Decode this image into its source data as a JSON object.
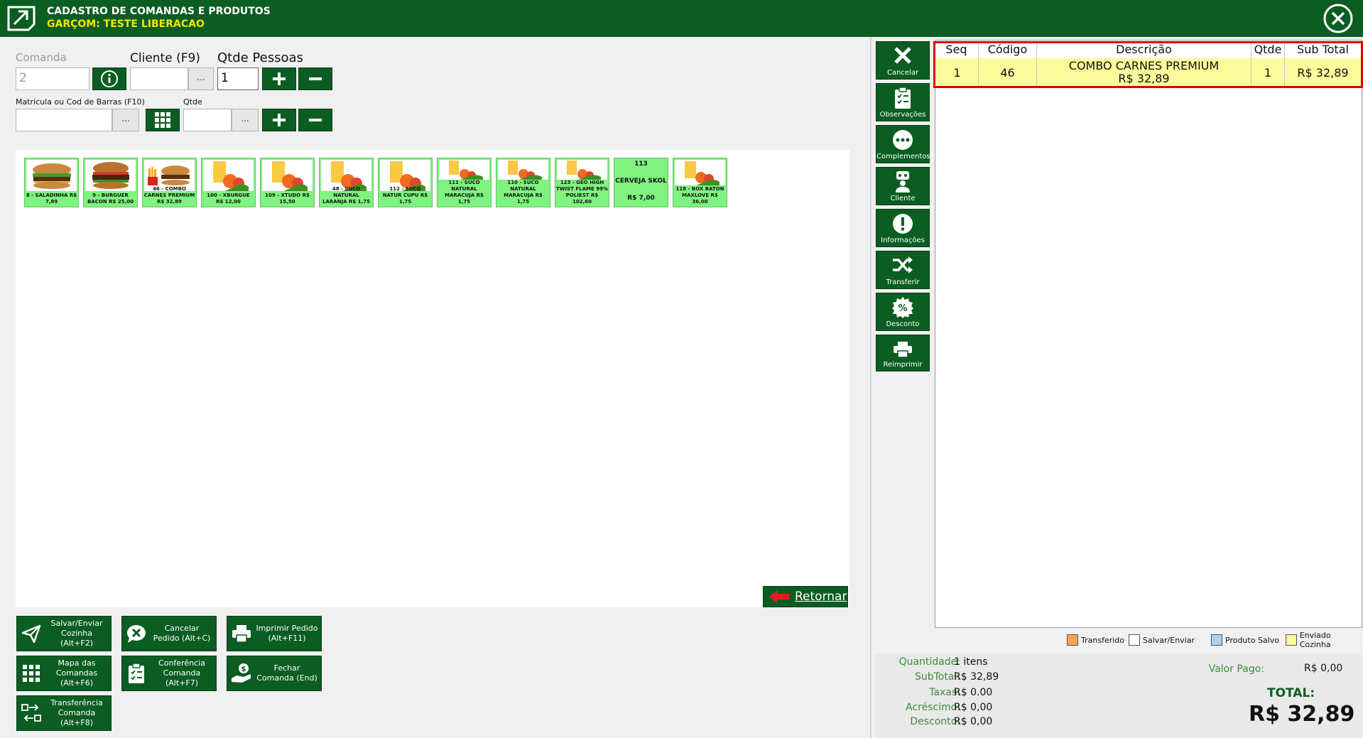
{
  "header": {
    "title": "CADASTRO DE COMANDAS E PRODUTOS",
    "subtitle": "GARÇOM: TESTE LIBERACAO"
  },
  "form": {
    "comanda_label": "Comanda",
    "comanda_value": "2",
    "cliente_label": "Cliente (F9)",
    "cliente_value": "",
    "pessoas_label": "Qtde Pessoas",
    "pessoas_value": "1",
    "matricula_label": "Matricula ou Cod de Barras (F10)",
    "matricula_value": "",
    "qtde_label": "Qtde",
    "qtde_value": "",
    "dots": "..."
  },
  "products": [
    {
      "caption": "8 - SALADINHA  R$ 7,89",
      "img": "burger"
    },
    {
      "caption": "9 - BURGUER BACON  R$ 25,00",
      "img": "burger2"
    },
    {
      "caption": "46 - COMBO CARNES PREMIUM R$ 32,89",
      "img": "combo"
    },
    {
      "caption": "100 - XBURGUE R$ 12,00",
      "img": "juice"
    },
    {
      "caption": "109 - XTUDO  R$ 15,50",
      "img": "juice"
    },
    {
      "caption": "48 - SUCO NATURAL LARANJA  R$ 1,75",
      "img": "juice"
    },
    {
      "caption": "112 - SUCO NATUR CUPU  R$ 1,75",
      "img": "juice"
    },
    {
      "caption": "111 - SUCO NATURAL MARACUJA  R$ 1,75",
      "img": "juice"
    },
    {
      "caption": "110 - SUCO NATURAL MARACUJA  R$ 1,75",
      "img": "juice"
    },
    {
      "caption": "123 - GEO HIGH TWIST FLAME 99% POLIEST  R$ 102,60",
      "img": "juice"
    },
    {
      "code": "113",
      "name": "CERVEJA SKOL",
      "price": "R$ 7,00"
    },
    {
      "caption": "118 - BOX BATON MAXLOVE  R$ 36,00",
      "img": "juice"
    }
  ],
  "retornar_label": "Retornar",
  "actions": {
    "salvar": "Salvar/Enviar Cozinha (Alt+F2)",
    "cancelar": "Cancelar Pedido (Alt+C)",
    "imprimir": "Imprimir Pedido (Alt+F11)",
    "mapa": "Mapa das Comandas (Alt+F6)",
    "conferencia": "Conferência Comanda (Alt+F7)",
    "fechar": "Fechar Comanda (End)",
    "transferencia": "Transferência Comanda (Alt+F8)"
  },
  "side": {
    "cancelar": "Cancelar",
    "observacoes": "Observações",
    "complementos": "Complementos",
    "cliente": "Cliente",
    "informacoes": "Informações",
    "transferir": "Transferir",
    "desconto": "Desconto",
    "reimprimir": "Reimprimir"
  },
  "table": {
    "headers": {
      "seq": "Seq",
      "codigo": "Código",
      "descricao": "Descrição",
      "qtde": "Qtde",
      "subtotal": "Sub Total"
    },
    "rows": [
      {
        "seq": "1",
        "codigo": "46",
        "descricao": "COMBO CARNES PREMIUM",
        "preco": "R$ 32,89",
        "qtde": "1",
        "subtotal": "R$ 32,89"
      }
    ]
  },
  "legend": {
    "transferido": "Transferido",
    "salvar": "Salvar/Enviar",
    "salvo": "Produto Salvo",
    "enviado": "Enviado Cozinha"
  },
  "totals": {
    "quantidade_label": "Quantidade:",
    "quantidade": "1 itens",
    "subtotal_label": "SubTotal:",
    "subtotal": "R$ 32,89",
    "taxas_label": "Taxas:",
    "taxas": "R$ 0.00",
    "acrescimo_label": "Acréscimo:",
    "acrescimo": "R$ 0,00",
    "desconto_label": "Desconto:",
    "desconto": "R$ 0,00",
    "valor_pago_label": "Valor Pago:",
    "valor_pago": "R$ 0,00",
    "total_label": "TOTAL:",
    "total": "R$ 32,89"
  },
  "colors": {
    "header_green": "#0b5d22",
    "tile_green": "#7ff27f",
    "row_yellow": "#fbfb9b",
    "highlight_red": "#e00000",
    "legend_orange": "#f5a352",
    "legend_blue": "#a8d0f0",
    "legend_yellow": "#fbfb9b"
  }
}
